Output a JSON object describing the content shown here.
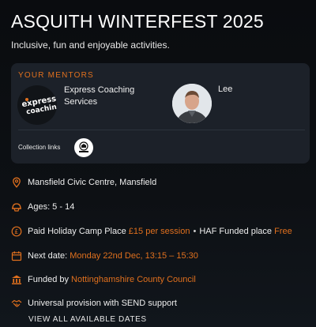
{
  "header": {
    "title": "ASQUITH WINTERFEST 2025",
    "subtitle": "Inclusive, fun and enjoyable activities."
  },
  "mentors": {
    "heading": "YOUR MENTORS",
    "items": [
      {
        "name": "Express Coaching Services",
        "logo_text_top": "express",
        "logo_text_bottom": "coaching"
      },
      {
        "name": "Lee"
      }
    ],
    "collection_label": "Collection links"
  },
  "details": {
    "location": "Mansfield Civic Centre, Mansfield",
    "ages": "Ages: 5 - 14",
    "price": {
      "paid_label": "Paid Holiday Camp Place",
      "paid_value": "£15 per session",
      "separator": "•",
      "funded_label": "HAF Funded place",
      "funded_value": "Free"
    },
    "next_date": {
      "label": "Next date:",
      "value": "Monday 22nd Dec, 13:15 – 15:30"
    },
    "funded_by": {
      "label": "Funded by",
      "value": "Nottinghamshire County Council"
    },
    "provision": "Universal provision with SEND support"
  },
  "actions": {
    "view_all": "VIEW ALL AVAILABLE DATES"
  },
  "colors": {
    "accent": "#e0701e",
    "card_bg": "#1c2129",
    "page_bg": "#0d1014"
  },
  "icons": [
    "location-pin-icon",
    "helmet-icon",
    "currency-icon",
    "calendar-icon",
    "bank-icon",
    "handshake-icon"
  ]
}
